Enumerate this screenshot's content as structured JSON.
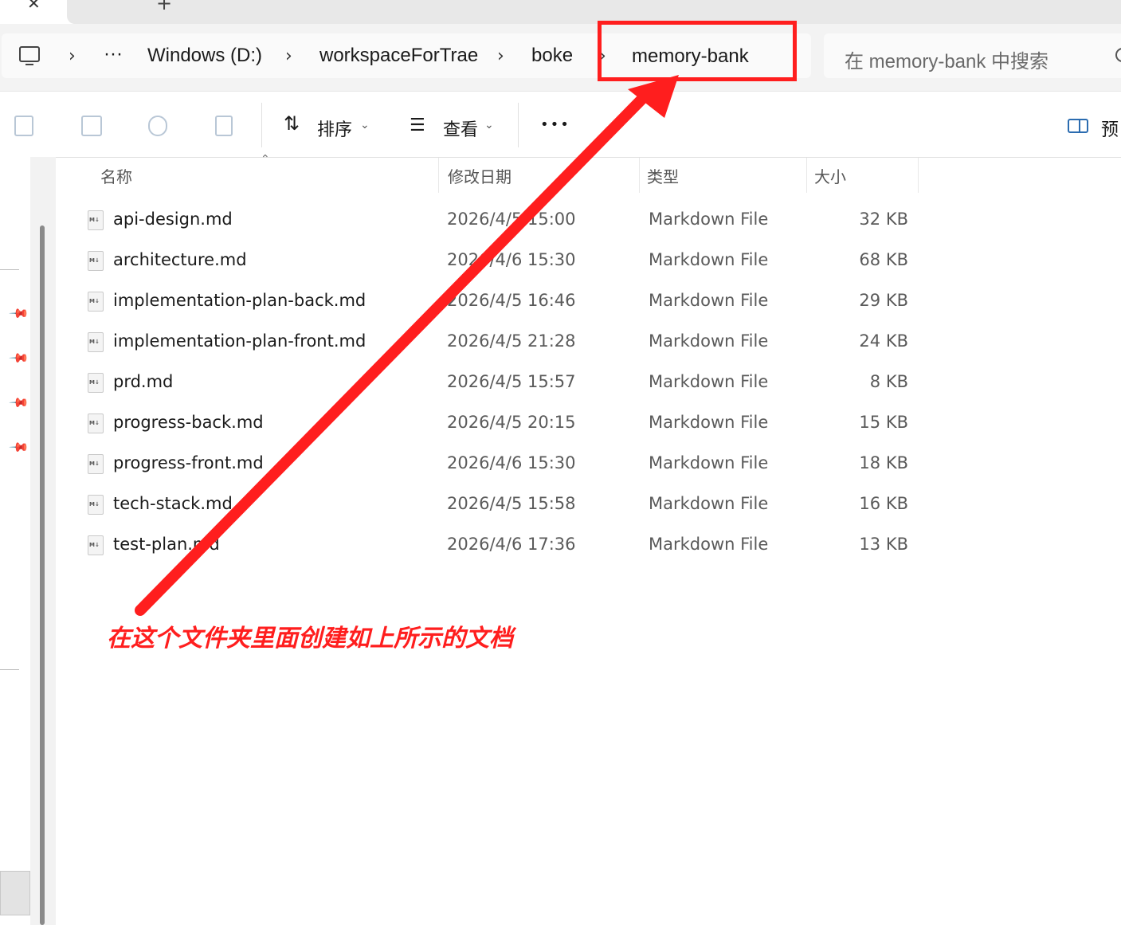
{
  "breadcrumb": {
    "ellipsis": "···",
    "items": [
      "Windows (D:)",
      "workspaceForTrae",
      "boke",
      "memory-bank"
    ]
  },
  "search": {
    "placeholder": "在 memory-bank 中搜索"
  },
  "toolbar": {
    "sort_label": "排序",
    "view_label": "查看",
    "more_label": "•••",
    "preview_label": "预"
  },
  "columns": {
    "name": "名称",
    "modified": "修改日期",
    "type": "类型",
    "size": "大小"
  },
  "files": [
    {
      "name": "api-design.md",
      "modified": "2026/4/5 15:00",
      "type": "Markdown File",
      "size": "32 KB"
    },
    {
      "name": "architecture.md",
      "modified": "2026/4/6 15:30",
      "type": "Markdown File",
      "size": "68 KB"
    },
    {
      "name": "implementation-plan-back.md",
      "modified": "2026/4/5 16:46",
      "type": "Markdown File",
      "size": "29 KB"
    },
    {
      "name": "implementation-plan-front.md",
      "modified": "2026/4/5 21:28",
      "type": "Markdown File",
      "size": "24 KB"
    },
    {
      "name": "prd.md",
      "modified": "2026/4/5 15:57",
      "type": "Markdown File",
      "size": "8 KB"
    },
    {
      "name": "progress-back.md",
      "modified": "2026/4/5 20:15",
      "type": "Markdown File",
      "size": "15 KB"
    },
    {
      "name": "progress-front.md",
      "modified": "2026/4/6 15:30",
      "type": "Markdown File",
      "size": "18 KB"
    },
    {
      "name": "tech-stack.md",
      "modified": "2026/4/5 15:58",
      "type": "Markdown File",
      "size": "16 KB"
    },
    {
      "name": "test-plan.md",
      "modified": "2026/4/6 17:36",
      "type": "Markdown File",
      "size": "13 KB"
    }
  ],
  "annotation": {
    "text": "在这个文件夹里面创建如上所示的文档",
    "color": "#ff1e1e"
  },
  "colors": {
    "accent": "#2b6cb0",
    "annotation": "#ff1e1e"
  }
}
